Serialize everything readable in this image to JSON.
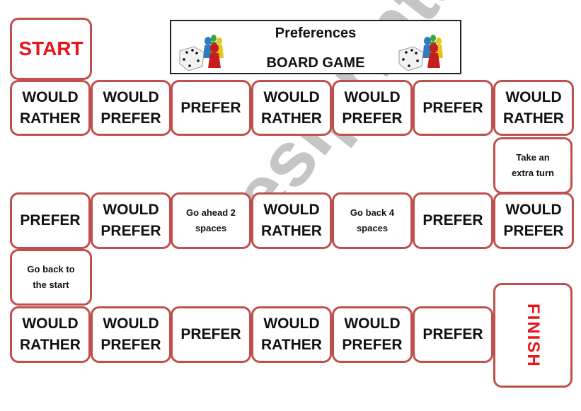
{
  "header": {
    "title": "Preferences",
    "subtitle": "BOARD GAME",
    "icons": [
      "dice-and-pawns-icon",
      "dice-and-pawns-icon"
    ]
  },
  "start_label": "START",
  "finish_label": "FINISH",
  "colors": {
    "cell_border": "#c0504d",
    "accent_red": "#e8161b",
    "text": "#111111"
  },
  "row1": [
    [
      "WOULD",
      "RATHER"
    ],
    [
      "WOULD",
      "PREFER"
    ],
    [
      "PREFER"
    ],
    [
      "WOULD",
      "RATHER"
    ],
    [
      "WOULD",
      "PREFER"
    ],
    [
      "PREFER"
    ],
    [
      "WOULD",
      "RATHER"
    ]
  ],
  "connector_right": [
    "Take an",
    "extra turn"
  ],
  "row2": [
    [
      "PREFER"
    ],
    [
      "WOULD",
      "PREFER"
    ],
    [
      "Go ahead 2",
      "spaces"
    ],
    [
      "WOULD",
      "RATHER"
    ],
    [
      "Go back 4",
      "spaces"
    ],
    [
      "PREFER"
    ],
    [
      "WOULD",
      "PREFER"
    ]
  ],
  "connector_left": [
    "Go back to",
    "the start"
  ],
  "row3": [
    [
      "WOULD",
      "RATHER"
    ],
    [
      "WOULD",
      "PREFER"
    ],
    [
      "PREFER"
    ],
    [
      "WOULD",
      "RATHER"
    ],
    [
      "WOULD",
      "PREFER"
    ],
    [
      "PREFER"
    ]
  ],
  "watermark": "eslprintables.com"
}
